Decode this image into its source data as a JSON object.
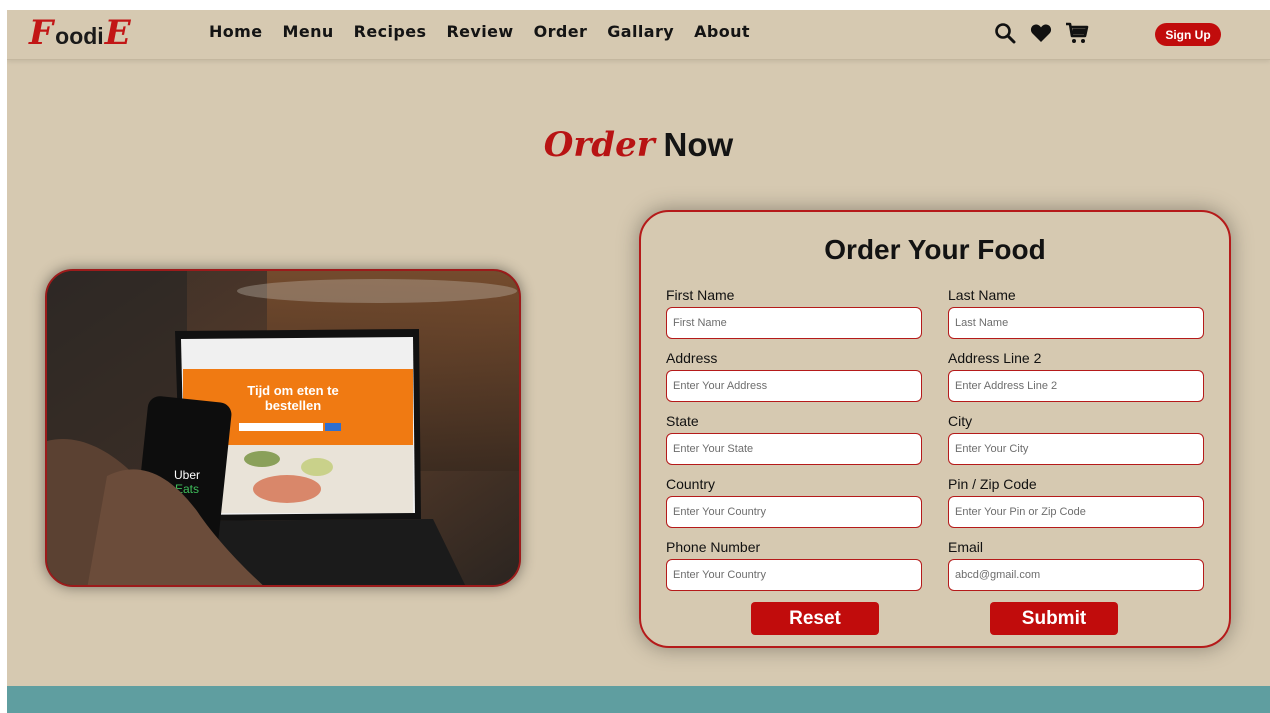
{
  "brand": {
    "logo_initial": "F",
    "logo_middle": "oodi",
    "logo_final": "E"
  },
  "nav": {
    "links": [
      {
        "label": "Home"
      },
      {
        "label": "Menu"
      },
      {
        "label": "Recipes"
      },
      {
        "label": "Review"
      },
      {
        "label": "Order"
      },
      {
        "label": "Gallary"
      },
      {
        "label": "About"
      }
    ],
    "icons": [
      "search-icon",
      "heart-icon",
      "cart-icon"
    ],
    "signup_label": "Sign Up"
  },
  "heading": {
    "script_word": "Order",
    "plain_word": "Now"
  },
  "photo": {
    "laptop_heading_line1": "Tijd om eten te",
    "laptop_heading_line2": "bestellen",
    "phone_text_line1": "Uber",
    "phone_text_line2": "Eats"
  },
  "form": {
    "title": "Order Your Food",
    "fields": [
      {
        "label": "First Name",
        "placeholder": "First Name"
      },
      {
        "label": "Last Name",
        "placeholder": "Last Name"
      },
      {
        "label": "Address",
        "placeholder": "Enter Your Address"
      },
      {
        "label": "Address Line 2",
        "placeholder": "Enter Address Line 2"
      },
      {
        "label": "State",
        "placeholder": "Enter Your State"
      },
      {
        "label": "City",
        "placeholder": "Enter Your City"
      },
      {
        "label": "Country",
        "placeholder": "Enter Your Country"
      },
      {
        "label": "Pin / Zip Code",
        "placeholder": "Enter Your Pin or Zip Code"
      },
      {
        "label": "Phone Number",
        "placeholder": "Enter Your Country"
      },
      {
        "label": "Email",
        "placeholder": "abcd@gmail.com"
      }
    ],
    "reset_label": "Reset",
    "submit_label": "Submit"
  },
  "colors": {
    "background": "#d6c9b1",
    "accent_red": "#c10c0c",
    "footer_band": "#5f9ea0",
    "text_dark": "#141414"
  }
}
